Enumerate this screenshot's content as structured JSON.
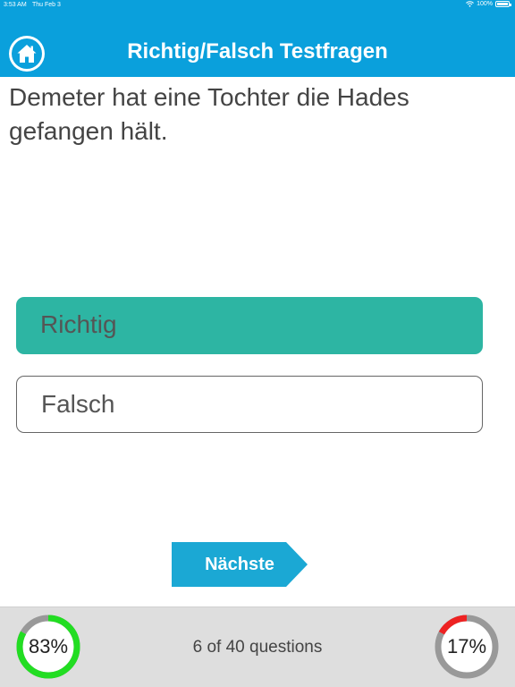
{
  "status_bar": {
    "time": "3:53 AM",
    "date": "Thu Feb 3",
    "battery": "100%"
  },
  "header": {
    "title": "Richtig/Falsch Testfragen",
    "background_color": "#0aa0dc"
  },
  "question": {
    "text": "Demeter hat eine Tochter die Hades gefangen hält."
  },
  "options": [
    {
      "label": "Richtig",
      "selected": true,
      "color": "#2db5a3"
    },
    {
      "label": "Falsch",
      "selected": false
    }
  ],
  "next_button": {
    "label": "Nächste",
    "color": "#1ba8d4"
  },
  "footer": {
    "progress_text": "6 of 40 questions",
    "correct_percent_label": "83%",
    "correct_fraction": 0.83,
    "correct_color": "#22dd22",
    "wrong_percent_label": "17%",
    "wrong_fraction": 0.17,
    "wrong_color": "#ee2222",
    "track_color": "#999999"
  }
}
